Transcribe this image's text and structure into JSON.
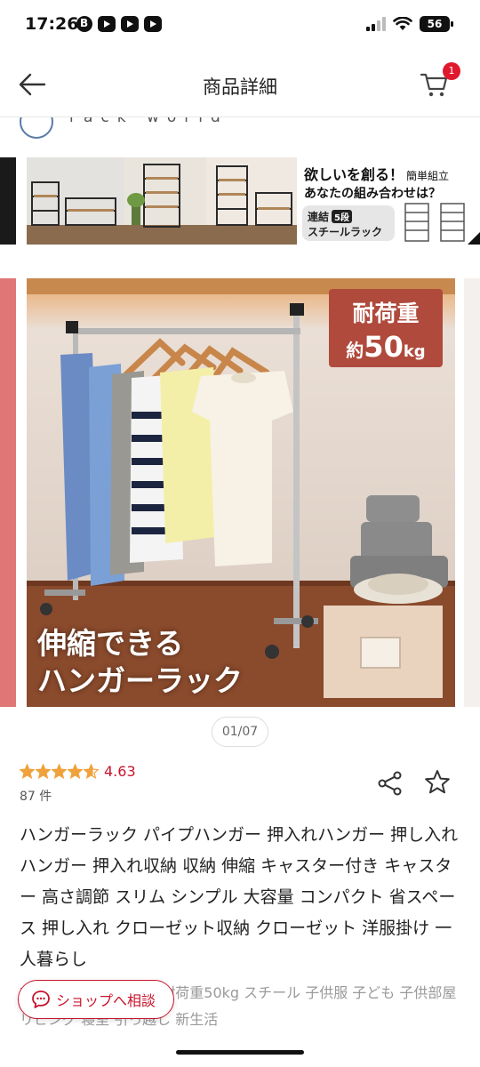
{
  "status_bar": {
    "time": "17:26",
    "battery": "56",
    "app_icons": [
      "b-app-icon",
      "youtube-icon",
      "youtube-icon",
      "youtube-icon"
    ]
  },
  "header": {
    "title": "商品詳細",
    "cart_count": "1",
    "back_icon": "arrow-left-icon",
    "cart_icon": "cart-icon"
  },
  "shop": {
    "name": "rack world"
  },
  "banner": {
    "headline_a": "欲しいを創る！",
    "headline_b": "簡単組立",
    "subline": "あなたの組み合わせは？",
    "tag_prefix": "連結",
    "tag_badge": "5段",
    "tag_line2": "スチールラック"
  },
  "hero": {
    "badge_line1": "耐荷重",
    "badge_prefix": "約",
    "badge_value": "50",
    "badge_unit": "kg",
    "caption": "伸縮できる\nハンガーラック",
    "pager": "01/07"
  },
  "rating": {
    "value": "4.63",
    "stars": 4.63,
    "count": "87 件",
    "star_color": "#f0a23c"
  },
  "product": {
    "title": "ハンガーラック パイプハンガー 押入れハンガー 押し入れハンガー 押入れ収納 収納 伸縮 キャスター付き キャスター 高さ調節 スリム シンプル 大容量 コンパクト 省スペース 押し入れ クローゼット収納 クローゼット 洋服掛け 一人暮らし",
    "subtitle": "衣類 物干し ハンガー 耐荷重50kg スチール 子供服 子ども 子供部屋 リビング 寝室 引っ越し 新生活"
  },
  "actions": {
    "consult_label": "ショップへ相談",
    "share_icon": "share-icon",
    "favorite_icon": "star-outline-icon"
  },
  "colors": {
    "accent": "#c8142c",
    "badge_red": "#e0182d",
    "weight_badge": "#b04a3c"
  }
}
